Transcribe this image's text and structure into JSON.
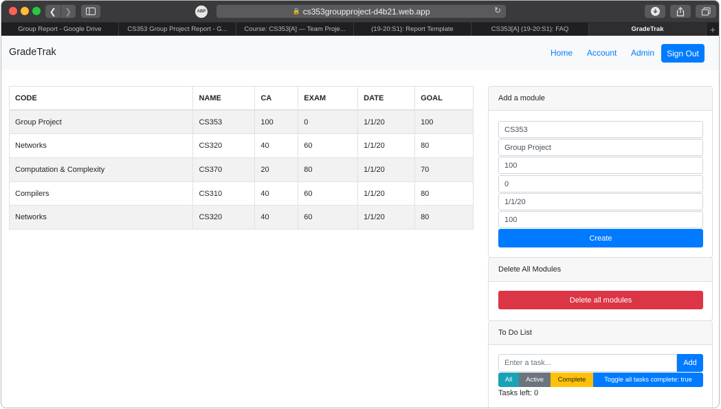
{
  "browser": {
    "url": "cs353groupproject-d4b21.web.app",
    "abp_label": "ABP",
    "tabs": [
      {
        "label": "Group Report - Google Drive"
      },
      {
        "label": "CS353 Group Project Report - G..."
      },
      {
        "label": "Course: CS353[A] — Team Proje..."
      },
      {
        "label": "(19-20:S1): Report Template"
      },
      {
        "label": "CS353[A] (19-20:S1): FAQ"
      },
      {
        "label": "GradeTrak"
      }
    ]
  },
  "navbar": {
    "brand": "GradeTrak",
    "links": {
      "home": "Home",
      "account": "Account",
      "admin": "Admin"
    },
    "signout": "Sign Out"
  },
  "table": {
    "headers": [
      "CODE",
      "NAME",
      "CA",
      "EXAM",
      "DATE",
      "GOAL"
    ],
    "rows": [
      [
        "Group Project",
        "CS353",
        "100",
        "0",
        "1/1/20",
        "100"
      ],
      [
        "Networks",
        "CS320",
        "40",
        "60",
        "1/1/20",
        "80"
      ],
      [
        "Computation & Complexity",
        "CS370",
        "20",
        "80",
        "1/1/20",
        "70"
      ],
      [
        "Compilers",
        "CS310",
        "40",
        "60",
        "1/1/20",
        "80"
      ],
      [
        "Networks",
        "CS320",
        "40",
        "60",
        "1/1/20",
        "80"
      ]
    ]
  },
  "add_module": {
    "title": "Add a module",
    "fields": [
      "CS353",
      "Group Project",
      "100",
      "0",
      "1/1/20",
      "100"
    ],
    "create_label": "Create"
  },
  "delete_modules": {
    "title": "Delete All Modules",
    "button_label": "Delete all modules"
  },
  "todo": {
    "title": "To Do List",
    "placeholder": "Enter a task...",
    "add_label": "Add",
    "filters": {
      "all": "All",
      "active": "Active",
      "complete": "Complete",
      "toggle": "Toggle all tasks complete: true"
    },
    "tasks_left": "Tasks left: 0"
  },
  "colors": {
    "primary": "#007bff",
    "danger": "#dc3545",
    "info": "#17a2b8",
    "secondary": "#6c757d",
    "warning": "#ffc107"
  }
}
